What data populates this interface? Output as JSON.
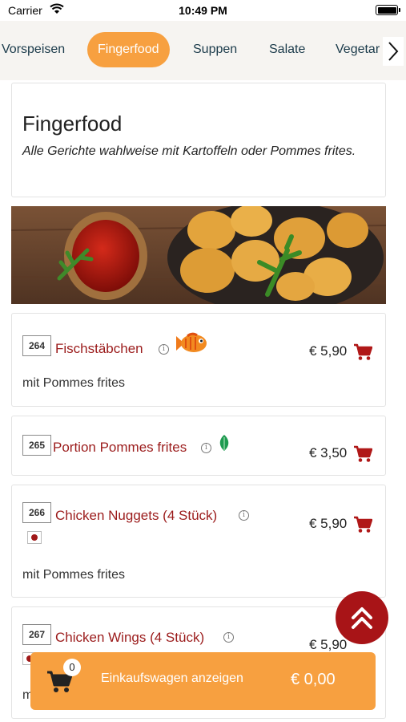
{
  "status_bar": {
    "carrier": "Carrier",
    "time": "10:49 PM"
  },
  "tabs": [
    {
      "label": "Vorspeisen"
    },
    {
      "label": "Fingerfood",
      "active": true
    },
    {
      "label": "Suppen"
    },
    {
      "label": "Salate"
    },
    {
      "label": "Vegetar"
    }
  ],
  "section": {
    "title": "Fingerfood",
    "subtitle": "Alle Gerichte wahlweise mit Kartoffeln oder Pommes frites."
  },
  "items": [
    {
      "number": "264",
      "name": "Fischstäbchen",
      "price": "€ 5,90",
      "description": "mit Pommes frites",
      "badge_icon": "fish-icon"
    },
    {
      "number": "265",
      "name": "Portion Pommes frites",
      "price": "€ 3,50",
      "description": "",
      "badge_icon": "leaf-icon"
    },
    {
      "number": "266",
      "name": "Chicken Nuggets (4 Stück)",
      "price": "€ 5,90",
      "description": "mit Pommes frites",
      "badge_icon": "allergen-icon"
    },
    {
      "number": "267",
      "name": "Chicken Wings (4 Stück)",
      "price": "€ 5,90",
      "description": "m",
      "badge_icon": "allergen-icon"
    }
  ],
  "cart": {
    "count": "0",
    "label": "Einkaufswagen anzeigen",
    "total": "€ 0,00"
  },
  "colors": {
    "accent": "#f7a040",
    "item_name": "#9b1b1b",
    "scroll_button": "#a81417",
    "tab_text": "#1a3a4a"
  }
}
